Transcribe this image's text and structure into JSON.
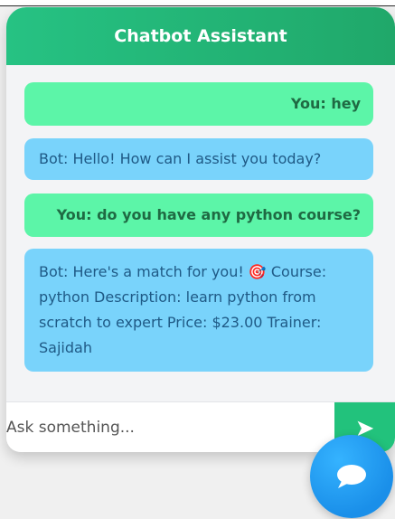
{
  "header": {
    "title": "Chatbot Assistant"
  },
  "messages": [
    {
      "role": "user",
      "text": "You: hey"
    },
    {
      "role": "bot",
      "text": "Bot: Hello! How can I assist you today?"
    },
    {
      "role": "user",
      "text": "You: do you have any python course?"
    },
    {
      "role": "bot",
      "text": "Bot: Here's a match for you! 🎯 Course: python Description: learn python from scratch to expert Price: $23.00 Trainer: Sajidah"
    }
  ],
  "input": {
    "placeholder": "Ask something..."
  },
  "send_button": {
    "label": "➤"
  },
  "fab": {
    "icon": "chat-bubble-icon"
  },
  "colors": {
    "header_bg": "#20a86a",
    "user_bubble": "#5cf5a8",
    "bot_bubble": "#79d3fb",
    "send_button": "#22c27c",
    "fab": "#1a8fe9"
  }
}
